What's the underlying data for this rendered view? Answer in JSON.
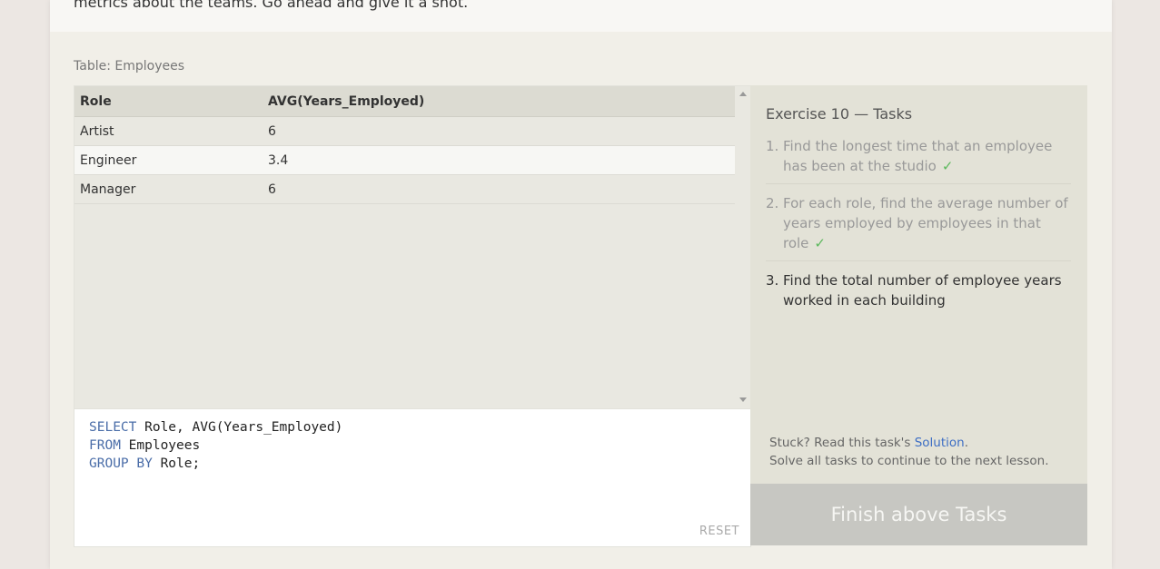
{
  "intro": {
    "text": "metrics about the teams. Go ahead and give it a shot."
  },
  "table": {
    "caption": "Table: Employees",
    "headers": [
      "Role",
      "AVG(Years_Employed)"
    ],
    "rows": [
      [
        "Artist",
        "6"
      ],
      [
        "Engineer",
        "3.4"
      ],
      [
        "Manager",
        "6"
      ]
    ]
  },
  "editor": {
    "line1_kw": "SELECT",
    "line1_rest": " Role, AVG(Years_Employed)",
    "line2_kw": "FROM",
    "line2_rest": " Employees",
    "line3_kw": "GROUP BY",
    "line3_rest": " Role;",
    "reset_label": "RESET"
  },
  "tasks": {
    "title": "Exercise 10 — Tasks",
    "items": [
      {
        "num": "1.",
        "text": "Find the longest time that an employee has been at the studio",
        "check": "✓"
      },
      {
        "num": "2.",
        "text": "For each role, find the average number of years employed by employees in that role",
        "check": "✓"
      },
      {
        "num": "3.",
        "text": "Find the total number of employee years worked in each building",
        "check": ""
      }
    ],
    "stuck_prefix": "Stuck? Read this task's ",
    "solution_link": "Solution",
    "stuck_suffix": ".",
    "continue_text": "Solve all tasks to continue to the next lesson.",
    "finish_button": "Finish above Tasks"
  },
  "colors": {
    "accent_link": "#3d6ec4",
    "check": "#5cb85c",
    "keyword": "#4a6da8"
  }
}
